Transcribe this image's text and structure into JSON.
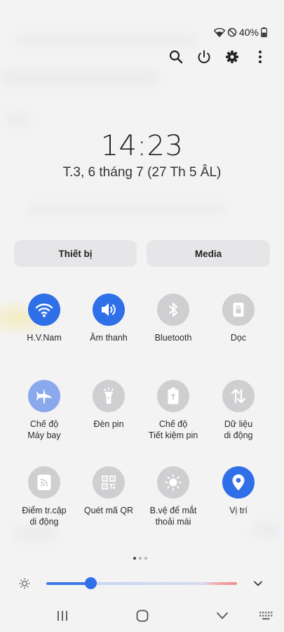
{
  "status_bar": {
    "battery_text": "40%",
    "icons": [
      "wifi-icon",
      "do-not-disturb-icon",
      "battery-icon"
    ]
  },
  "top_actions": [
    "search-icon",
    "power-icon",
    "settings-icon",
    "more-icon"
  ],
  "clock": {
    "time": "14:23",
    "date": "T.3, 6 tháng 7 (27 Th 5 ÂL)"
  },
  "segments": {
    "device": "Thiết bị",
    "media": "Media"
  },
  "tiles": [
    {
      "label": "H.V.Nam",
      "icon": "wifi-icon",
      "state": "on"
    },
    {
      "label": "Âm thanh",
      "icon": "sound-icon",
      "state": "on"
    },
    {
      "label": "Bluetooth",
      "icon": "bluetooth-icon",
      "state": "off"
    },
    {
      "label": "Dọc",
      "icon": "portrait-lock-icon",
      "state": "off"
    },
    {
      "label": "Chế độ\nMáy bay",
      "icon": "airplane-icon",
      "state": "dim"
    },
    {
      "label": "Đèn pin",
      "icon": "flashlight-icon",
      "state": "off"
    },
    {
      "label": "Chế độ\nTiết kiệm pin",
      "icon": "power-saving-icon",
      "state": "off"
    },
    {
      "label": "Dữ liệu\ndi động",
      "icon": "mobile-data-icon",
      "state": "off"
    },
    {
      "label": "Điểm tr.cập\ndi động",
      "icon": "hotspot-icon",
      "state": "off"
    },
    {
      "label": "Quét mã QR",
      "icon": "qr-scan-icon",
      "state": "off"
    },
    {
      "label": "B.vệ để mắt\nthoải mái",
      "icon": "eye-comfort-icon",
      "state": "off"
    },
    {
      "label": "Vị trí",
      "icon": "location-icon",
      "state": "on"
    }
  ],
  "pagination": {
    "pages": 3,
    "active": 1
  },
  "brightness": {
    "level": 0.23
  },
  "colors": {
    "accent": "#2f6fe8",
    "tile_off": "#cfcfd2",
    "tile_dim": "#8aa8ec",
    "background": "#f3f3f4"
  },
  "nav_bar": [
    "recents-icon",
    "home-icon",
    "back-icon",
    "keyboard-icon"
  ]
}
